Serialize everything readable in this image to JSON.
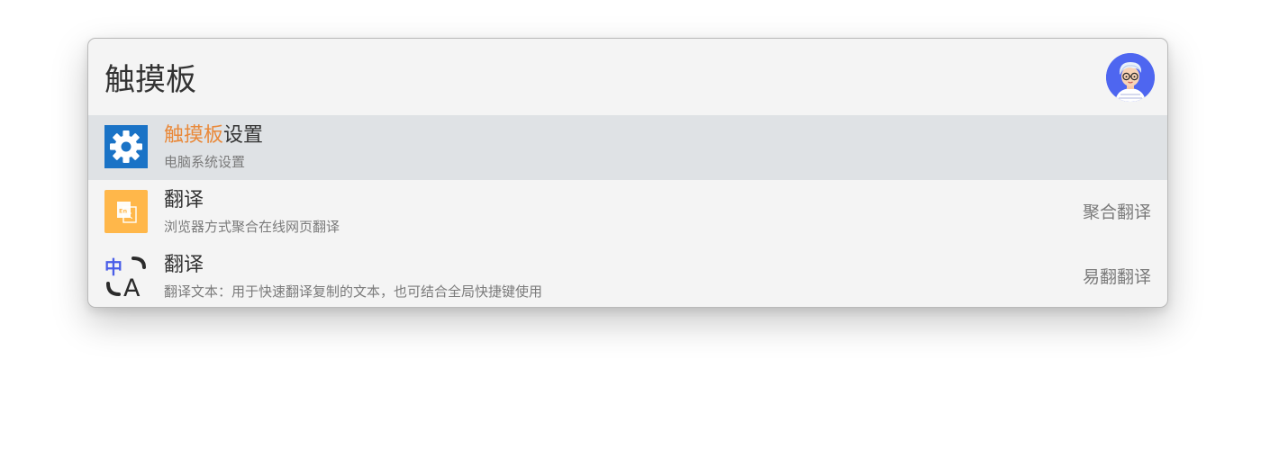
{
  "search": {
    "query": "触摸板"
  },
  "colors": {
    "highlight": "#e9893a",
    "selected_row": "#dfe2e5",
    "avatar_bg": "#4e66f0",
    "settings_icon_bg": "#1a73c6",
    "translate_icon_bg": "#ffb74a"
  },
  "results": [
    {
      "title_highlight": "触摸板",
      "title_rest": "设置",
      "subtitle": "电脑系统设置",
      "tag": "",
      "icon": "gear-icon",
      "selected": true
    },
    {
      "title": "翻译",
      "subtitle": "浏览器方式聚合在线网页翻译",
      "tag": "聚合翻译",
      "icon": "translate-document-icon",
      "icon_text": "En"
    },
    {
      "title": "翻译",
      "subtitle": "翻译文本：用于快速翻译复制的文本，也可结合全局快捷键使用",
      "tag": "易翻翻译",
      "icon": "language-translate-icon",
      "icon_text_cn": "中",
      "icon_text_en": "A"
    }
  ]
}
